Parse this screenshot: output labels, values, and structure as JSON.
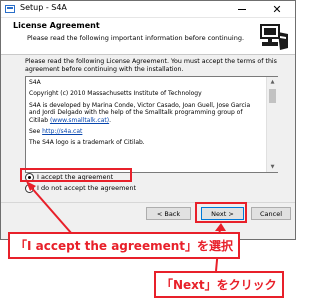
{
  "window": {
    "title": "Setup - S4A"
  },
  "header": {
    "title": "License Agreement",
    "subtitle": "Please read the following important information before continuing."
  },
  "instruction": "Please read the following License Agreement. You must accept the terms of this agreement before continuing with the installation.",
  "license": {
    "paragraphs": [
      "S4A",
      "Copyright (c) 2010 Massachusetts Institute of Technology",
      "S4A is developed by Marina Conde, Victor Casado, Joan Guell, Jose Garcia and Jordi Delgado with the help of the Smalltalk programming group of Citilab",
      "See",
      "The S4A logo is a trademark of Citilab."
    ],
    "link_citilab": "(www.smalltalk.cat)",
    "link_s4a": "http://s4a.cat"
  },
  "options": {
    "accept": "I accept the agreement",
    "decline": "I do not accept the agreement"
  },
  "buttons": {
    "back": "< Back",
    "next": "Next >",
    "cancel": "Cancel"
  },
  "annotations": {
    "accept_callout": "「I accept the agreement」を選択",
    "next_callout": "「Next」をクリック"
  },
  "colors": {
    "highlight": "#e8202a",
    "link": "#0645ad"
  }
}
